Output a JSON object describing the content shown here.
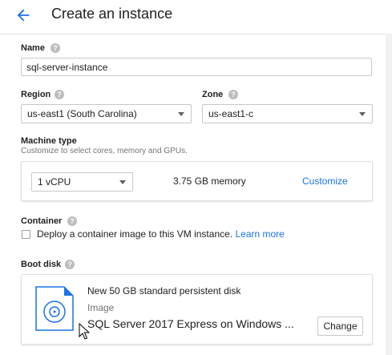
{
  "header": {
    "back_icon": "arrow-back-icon",
    "title": "Create an instance"
  },
  "name": {
    "label": "Name",
    "value": "sql-server-instance",
    "help_icon": "help-icon"
  },
  "region": {
    "label": "Region",
    "selected": "us-east1 (South Carolina)"
  },
  "zone": {
    "label": "Zone",
    "selected": "us-east1-c"
  },
  "machine_type": {
    "label": "Machine type",
    "description": "Customize to select cores, memory and GPUs.",
    "cpu_selected": "1 vCPU",
    "memory": "3.75 GB memory",
    "customize_label": "Customize"
  },
  "container": {
    "label": "Container",
    "checkbox_label": "Deploy a container image to this VM instance.",
    "learn_more": "Learn more",
    "checked": false
  },
  "boot_disk": {
    "label": "Boot disk",
    "disk_title": "New 50 GB standard persistent disk",
    "image_type": "Image",
    "image_name": "SQL Server 2017 Express on Windows ...",
    "change_label": "Change"
  },
  "colors": {
    "accent": "#1a73e8",
    "help_icon": "#bdbdbd",
    "border": "#c8c8c8"
  }
}
